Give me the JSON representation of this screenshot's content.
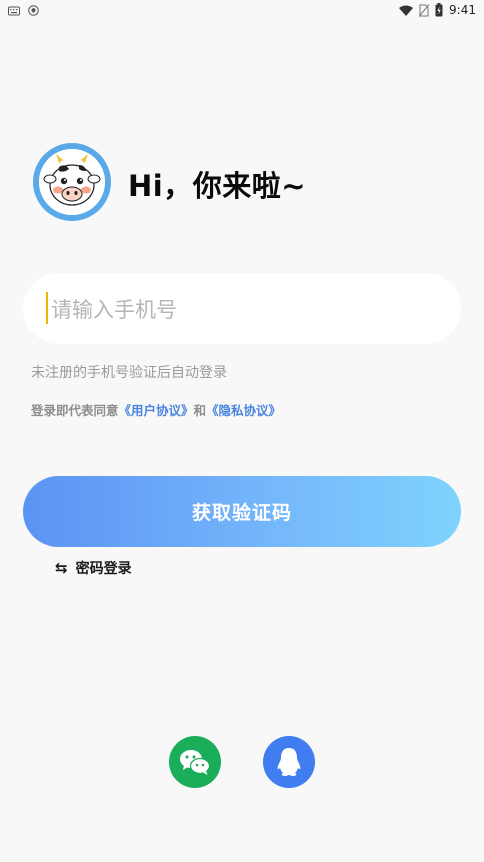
{
  "status_bar": {
    "time": "9:41",
    "icons": [
      "keyboard-icon",
      "shield-icon",
      "wifi-icon",
      "no-sim-icon",
      "battery-charging-icon"
    ]
  },
  "greeting": {
    "avatar": "cow-avatar-icon",
    "text": "Hi，你来啦~"
  },
  "phone": {
    "placeholder": "请输入手机号",
    "value": ""
  },
  "hint": "未注册的手机号验证后自动登录",
  "agreement": {
    "prefix": "登录即代表同意",
    "user_agreement": "《用户协议》",
    "conjunction": "和",
    "privacy_policy": "《隐私协议》"
  },
  "get_code_button": "获取验证码",
  "password_login": {
    "icon": "swap-arrows-icon",
    "label": "密码登录"
  },
  "social": [
    "wechat-icon",
    "qq-icon"
  ],
  "colors": {
    "accent_start": "#5b93f4",
    "accent_end": "#7ed3fd",
    "link": "#4a84e0",
    "wechat": "#1aad5a",
    "qq": "#3f7df0",
    "caret": "#f0b400"
  }
}
